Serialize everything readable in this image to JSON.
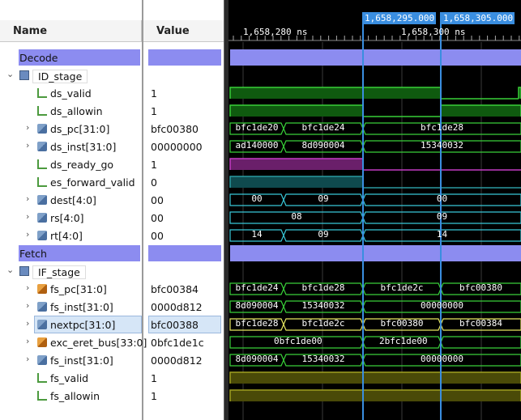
{
  "headers": {
    "name": "Name",
    "value": "Value"
  },
  "cursors": [
    {
      "label": "1,658,295.000"
    },
    {
      "label": "1,658,305.000"
    }
  ],
  "ruler": {
    "labels": [
      "1,658,280 ns",
      "1,658,300 ns"
    ]
  },
  "rows": [
    {
      "type": "group",
      "name": "Decode",
      "value": ""
    },
    {
      "type": "scope",
      "name": "ID_stage",
      "value": ""
    },
    {
      "type": "bit",
      "name": "ds_valid",
      "value": "1"
    },
    {
      "type": "bit",
      "name": "ds_allowin",
      "value": "1"
    },
    {
      "type": "bus",
      "name": "ds_pc[31:0]",
      "value": "bfc00380"
    },
    {
      "type": "bus",
      "name": "ds_inst[31:0]",
      "value": "00000000"
    },
    {
      "type": "bit",
      "name": "ds_ready_go",
      "value": "1"
    },
    {
      "type": "bit",
      "name": "es_forward_valid",
      "value": "0"
    },
    {
      "type": "bus",
      "name": "dest[4:0]",
      "value": "00"
    },
    {
      "type": "bus",
      "name": "rs[4:0]",
      "value": "00"
    },
    {
      "type": "bus",
      "name": "rt[4:0]",
      "value": "00"
    },
    {
      "type": "group",
      "name": "Fetch",
      "value": ""
    },
    {
      "type": "scope",
      "name": "IF_stage",
      "value": ""
    },
    {
      "type": "busorg",
      "name": "fs_pc[31:0]",
      "value": "bfc00384"
    },
    {
      "type": "bus",
      "name": "fs_inst[31:0]",
      "value": "0000d812"
    },
    {
      "type": "bus",
      "name": "nextpc[31:0]",
      "value": "bfc00388",
      "selected": true
    },
    {
      "type": "busorg",
      "name": "exc_eret_bus[33:0]",
      "value": "0bfc1de1c"
    },
    {
      "type": "bus",
      "name": "fs_inst[31:0]",
      "value": "0000d812"
    },
    {
      "type": "bit",
      "name": "fs_valid",
      "value": "1"
    },
    {
      "type": "bit",
      "name": "fs_allowin",
      "value": "1"
    }
  ],
  "waves": {
    "ds_pc": [
      "bfc1de20",
      "bfc1de24",
      "bfc1de28"
    ],
    "ds_inst": [
      "ad140000",
      "8d090004",
      "15340032"
    ],
    "dest": [
      "00",
      "09",
      "00"
    ],
    "rs": [
      "08",
      "09"
    ],
    "rt": [
      "14",
      "09",
      "14"
    ],
    "fs_pc": [
      "bfc1de24",
      "bfc1de28",
      "bfc1de2c",
      "bfc00380"
    ],
    "fs_inst": [
      "8d090004",
      "15340032",
      "00000000"
    ],
    "nextpc": [
      "bfc1de28",
      "bfc1de2c",
      "bfc00380",
      "bfc00384"
    ],
    "exc_eret_bus": [
      "0bfc1de00",
      "2bfc1de00"
    ],
    "fs_inst2": [
      "8d090004",
      "15340032",
      "00000000"
    ]
  },
  "colors": {
    "group_bar": "#8c8cf0",
    "bit_wave": "#39d039",
    "bit_fill": "#0f5a0f",
    "bus_wave": "#39d039",
    "purple": "#c43cc4",
    "teal": "#2a9aa0",
    "cyan_bus": "#38c8d8",
    "yellow": "#a0a020",
    "cursor": "#3a8ee0"
  }
}
